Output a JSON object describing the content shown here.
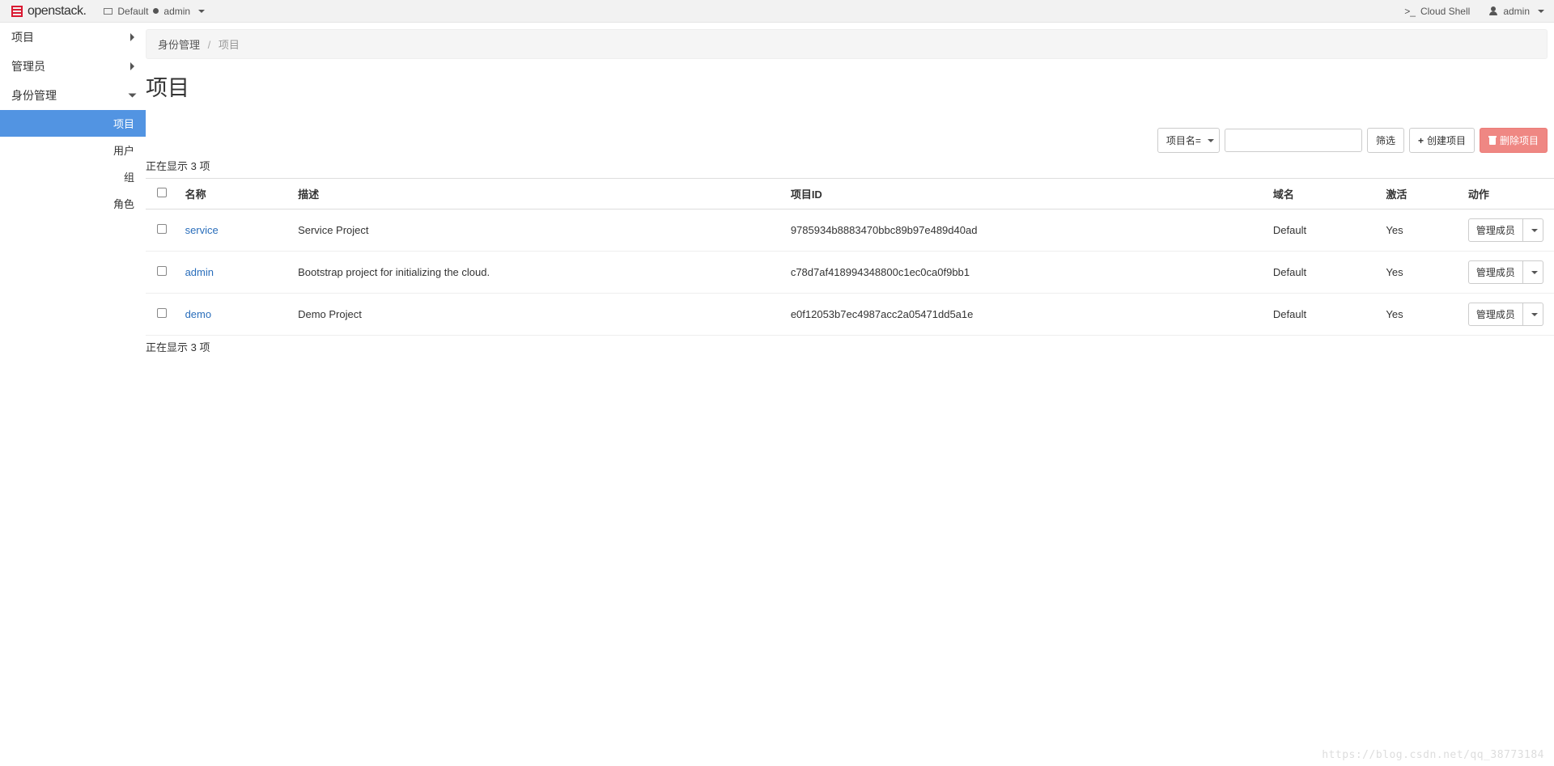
{
  "topbar": {
    "brand": "openstack.",
    "domain": "Default",
    "project": "admin",
    "cloudshell": "Cloud Shell",
    "user": "admin"
  },
  "sidebar": {
    "groups": [
      {
        "label": "项目",
        "expanded": false
      },
      {
        "label": "管理员",
        "expanded": false
      },
      {
        "label": "身份管理",
        "expanded": true
      }
    ],
    "identity_items": [
      {
        "label": "项目",
        "active": true
      },
      {
        "label": "用户",
        "active": false
      },
      {
        "label": "组",
        "active": false
      },
      {
        "label": "角色",
        "active": false
      }
    ]
  },
  "breadcrumb": {
    "root": "身份管理",
    "current": "项目"
  },
  "page": {
    "title": "项目"
  },
  "toolbar": {
    "filter_field_label": "项目名=",
    "filter_value": "",
    "filter_button": "筛选",
    "create_button": "创建项目",
    "delete_button": "删除项目"
  },
  "table": {
    "count_text_top": "正在显示 3 项",
    "count_text_bottom": "正在显示 3 项",
    "headers": {
      "name": "名称",
      "description": "描述",
      "id": "项目ID",
      "domain": "域名",
      "active": "激活",
      "action": "动作"
    },
    "rows": [
      {
        "name": "service",
        "description": "Service Project",
        "id": "9785934b8883470bbc89b97e489d40ad",
        "domain": "Default",
        "active": "Yes",
        "action": "管理成员"
      },
      {
        "name": "admin",
        "description": "Bootstrap project for initializing the cloud.",
        "id": "c78d7af418994348800c1ec0ca0f9bb1",
        "domain": "Default",
        "active": "Yes",
        "action": "管理成员"
      },
      {
        "name": "demo",
        "description": "Demo Project",
        "id": "e0f12053b7ec4987acc2a05471dd5a1e",
        "domain": "Default",
        "active": "Yes",
        "action": "管理成员"
      }
    ]
  },
  "watermark": "https://blog.csdn.net/qq_38773184"
}
